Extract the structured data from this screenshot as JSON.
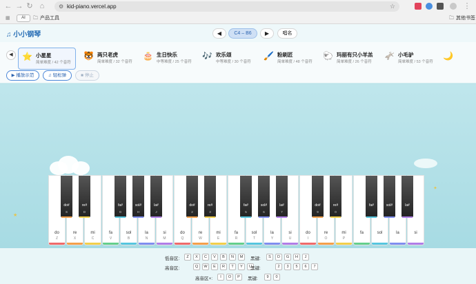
{
  "browser": {
    "url": "kid-piano.vercel.app",
    "bookmarks": {
      "ai_tag": "AI",
      "folder": "产品工具",
      "other": "其他书签"
    }
  },
  "app": {
    "title": "小小钢琴",
    "range": "C4 – B6",
    "name_button": "唱名"
  },
  "songs": [
    {
      "icon": "⭐",
      "name": "小星星",
      "meta": "简单难度 / 42 个音符",
      "active": true
    },
    {
      "icon": "🐯",
      "name": "两只老虎",
      "meta": "简单难度 / 32 个音符"
    },
    {
      "icon": "🎂",
      "name": "生日快乐",
      "meta": "中等难度 / 25 个音符"
    },
    {
      "icon": "🎶",
      "name": "欢乐颂",
      "meta": "中等难度 / 30 个音符"
    },
    {
      "icon": "🖌️",
      "name": "粉刷匠",
      "meta": "简单难度 / 48 个音符"
    },
    {
      "icon": "🐑",
      "name": "玛丽有只小羊羔",
      "meta": "简单难度 / 26 个音符"
    },
    {
      "icon": "🫏",
      "name": "小毛驴",
      "meta": "简单难度 / 53 个音符"
    },
    {
      "icon": "🌙",
      "name": ""
    }
  ],
  "controls": {
    "demo": "▶ 播放示范",
    "practice": "♫ 轻松弹",
    "stop": "■ 停止"
  },
  "white_keys": [
    {
      "n": "do",
      "k": "Z"
    },
    {
      "n": "re",
      "k": "X"
    },
    {
      "n": "mi",
      "k": "C"
    },
    {
      "n": "fa",
      "k": "V"
    },
    {
      "n": "sol",
      "k": "B"
    },
    {
      "n": "la",
      "k": "N"
    },
    {
      "n": "si",
      "k": "M"
    },
    {
      "n": "do",
      "k": "Q"
    },
    {
      "n": "re",
      "k": "W"
    },
    {
      "n": "mi",
      "k": "E"
    },
    {
      "n": "fa",
      "k": "R"
    },
    {
      "n": "sol",
      "k": "T"
    },
    {
      "n": "la",
      "k": "Y"
    },
    {
      "n": "si",
      "k": "U"
    },
    {
      "n": "do",
      "k": "I"
    },
    {
      "n": "re",
      "k": "O"
    },
    {
      "n": "mi",
      "k": "P"
    },
    {
      "n": "fa",
      "k": ""
    },
    {
      "n": "sol",
      "k": ""
    },
    {
      "n": "la",
      "k": ""
    },
    {
      "n": "si",
      "k": ""
    }
  ],
  "black_keys": [
    {
      "n": "do#",
      "k": "S"
    },
    {
      "n": "re#",
      "k": "D"
    },
    {
      "n": "fa#",
      "k": "G"
    },
    {
      "n": "sol#",
      "k": "H"
    },
    {
      "n": "la#",
      "k": "J"
    },
    {
      "n": "do#",
      "k": "2"
    },
    {
      "n": "re#",
      "k": "3"
    },
    {
      "n": "fa#",
      "k": "5"
    },
    {
      "n": "sol#",
      "k": "6"
    },
    {
      "n": "la#",
      "k": "7"
    },
    {
      "n": "do#",
      "k": "9"
    },
    {
      "n": "re#",
      "k": "0"
    },
    {
      "n": "fa#",
      "k": ""
    },
    {
      "n": "sol#",
      "k": ""
    },
    {
      "n": "la#",
      "k": ""
    }
  ],
  "note_colors": [
    "#ef6b6b",
    "#f5a04a",
    "#f2cf4a",
    "#63cf8c",
    "#55c6df",
    "#7f8ef0",
    "#b07de8"
  ],
  "legend": {
    "low_label": "低音区:",
    "low_keys": [
      "Z",
      "X",
      "C",
      "V",
      "B",
      "N",
      "M"
    ],
    "low_black_label": "黑键:",
    "low_black_keys": [
      "S",
      "D",
      "G",
      "H",
      "J"
    ],
    "high_label": "高音区:",
    "high_keys": [
      "Q",
      "W",
      "E",
      "R",
      "T",
      "Y",
      "U"
    ],
    "high_black_label": "黑键:",
    "high_black_keys": [
      "2",
      "3",
      "5",
      "6",
      "7"
    ],
    "highplus_label": "高音区+:",
    "highplus_keys": [
      "I",
      "O",
      "P"
    ],
    "highplus_black_label": "黑键:",
    "highplus_black_keys": [
      "9",
      "0"
    ]
  }
}
